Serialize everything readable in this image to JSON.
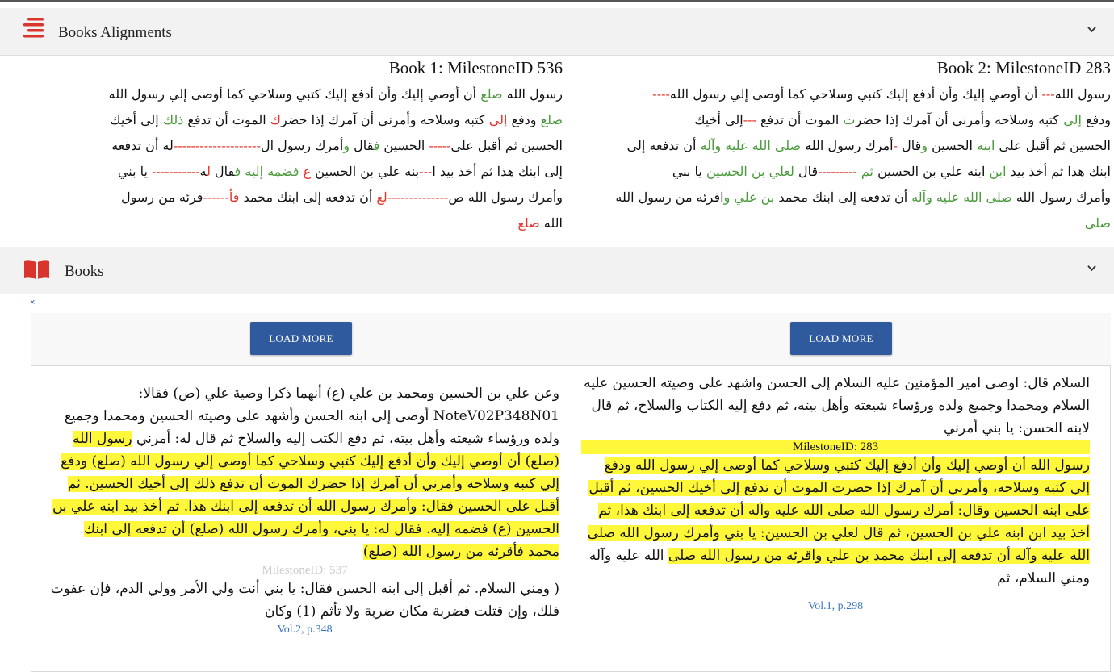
{
  "alignments_panel": {
    "title": "Books Alignments",
    "book1_heading": "Book 1: MilestoneID 536",
    "book2_heading": "Book 2: MilestoneID 283"
  },
  "book1_alignment_lines": [
    [
      {
        "t": "رسول الله "
      },
      {
        "t": "صلع",
        "c": "g"
      },
      {
        "t": " أن أوصي إليك وأن أدفع إليك كتبي وسلاحي كما أوصى إلي رسول الله"
      }
    ],
    [
      {
        "t": "صلع",
        "c": "g"
      },
      {
        "t": " ودفع "
      },
      {
        "t": "إلى",
        "c": "r"
      },
      {
        "t": " كتبه وسلاحه وأمرني أن آمرك إذا حضر"
      },
      {
        "t": "ك",
        "c": "r"
      },
      {
        "t": " الموت أن تدفع "
      },
      {
        "t": "ذلك",
        "c": "g"
      },
      {
        "t": " إلى أخيك"
      }
    ],
    [
      {
        "t": "الحسين ثم أقبل على"
      },
      {
        "t": "-----",
        "c": "r"
      },
      {
        "t": " الحسين "
      },
      {
        "t": "ف",
        "c": "g"
      },
      {
        "t": "قال "
      },
      {
        "t": "و",
        "c": "g"
      },
      {
        "t": "أمرك رسول ال"
      },
      {
        "t": "--------------------",
        "c": "r"
      },
      {
        "t": "له أن تدفعه"
      }
    ],
    [
      {
        "t": "إلى ابنك هذا ثم أخذ بيد ا"
      },
      {
        "t": "---",
        "c": "r"
      },
      {
        "t": "بنه علي بن الحسين "
      },
      {
        "t": "ع",
        "c": "r"
      },
      {
        "t": " "
      },
      {
        "t": "فضمه إليه",
        "c": "g"
      },
      {
        "t": " "
      },
      {
        "t": "ف",
        "c": "g"
      },
      {
        "t": "قال "
      },
      {
        "t": "ل",
        "c": "r"
      },
      {
        "t": "ه"
      },
      {
        "t": "-----------",
        "c": "r"
      },
      {
        "t": " يا بني"
      }
    ],
    [
      {
        "t": "وأمرك رسول الله ص"
      },
      {
        "t": "--------------",
        "c": "r"
      },
      {
        "t": "لع",
        "c": "r"
      },
      {
        "t": " أن تدفعه إلى ابنك محمد "
      },
      {
        "t": "فأ",
        "c": "r"
      },
      {
        "t": "------",
        "c": "r"
      },
      {
        "t": "قرئه من رسول"
      }
    ],
    [
      {
        "t": "الله "
      },
      {
        "t": "صلع",
        "c": "r"
      }
    ]
  ],
  "book2_alignment_lines": [
    [
      {
        "t": "رسول الله"
      },
      {
        "t": "---",
        "c": "r"
      },
      {
        "t": " أن أوصي إليك وأن أدفع إليك كتبي وسلاحي كما أوصى إلي رسول الله"
      },
      {
        "t": "----",
        "c": "r"
      }
    ],
    [
      {
        "t": "ودفع "
      },
      {
        "t": "إلي",
        "c": "g"
      },
      {
        "t": " كتبه وسلاحه وأمرني أن آمرك إذا حضر"
      },
      {
        "t": "ت",
        "c": "g"
      },
      {
        "t": " الموت أن تدفع "
      },
      {
        "t": "---",
        "c": "r"
      },
      {
        "t": "إلى أخيك"
      }
    ],
    [
      {
        "t": "الحسين ثم أقبل على "
      },
      {
        "t": "ابنه",
        "c": "g"
      },
      {
        "t": " الحسين "
      },
      {
        "t": "و",
        "c": "g"
      },
      {
        "t": "قال "
      },
      {
        "t": "-",
        "c": "r"
      },
      {
        "t": "أمرك رسول الله "
      },
      {
        "t": "صلى الله عليه",
        "c": "g"
      },
      {
        "t": " "
      },
      {
        "t": "وآله",
        "c": "g"
      },
      {
        "t": " أن تدفعه إلى"
      }
    ],
    [
      {
        "t": "ابنك هذا ثم أخذ بيد "
      },
      {
        "t": "ابن",
        "c": "g"
      },
      {
        "t": " ابنه علي بن الحسين "
      },
      {
        "t": "ثم",
        "c": "g"
      },
      {
        "t": " "
      },
      {
        "t": "---------",
        "c": "r"
      },
      {
        "t": "قال "
      },
      {
        "t": "لعلي بن الحسين",
        "c": "g"
      },
      {
        "t": " يا بني"
      }
    ],
    [
      {
        "t": "وأمرك رسول الله "
      },
      {
        "t": "صلى الله عليه وآله",
        "c": "g"
      },
      {
        "t": " أن تدفعه إلى ابنك محمد "
      },
      {
        "t": "بن علي",
        "c": "g"
      },
      {
        "t": " "
      },
      {
        "t": "و",
        "c": "g"
      },
      {
        "t": "اقرئه من رسول الله"
      }
    ],
    [
      {
        "t": "صلى",
        "c": "g"
      }
    ]
  ],
  "books_panel": {
    "title": "Books",
    "close_symbol": "×",
    "load_more_label": "LOAD MORE"
  },
  "book1_page": {
    "before": "وعن علي بن الحسين ومحمد بن علي (ع) أنهما ذكرا وصية علي (ص) فقالا: NoteV02P348N01 أوصى إلى ابنه الحسن وأشهد على وصيته الحسين ومحمدا وجميع ولده ورؤساء شيعته وأهل بيته، ثم دفع الكتب إليه والسلاح ثم قال له: أمرني ",
    "highlight": "رسول الله (صلع) أن أوصي إليك وأن أدفع إليك كتبي وسلاحي كما أوصى إلي رسول الله (صلع) ودفع إلي كتبه وسلاحه وأمرني أن آمرك إذا حضرك الموت أن تدفع ذلك إلى أخيك الحسين. ثم أقبل على الحسين فقال: وأمرك رسول الله أن تدفعه إلى ابنك هذا. ثم أخذ بيد ابنه علي بن الحسين (ع) فضمه إليه. فقال له: يا بني، وأمرك رسول الله (صلع) أن تدفعه إلى ابنك محمد فأقرئه من رسول الله (صلع)",
    "milestone": "MilestoneID: 537",
    "after": "( ومني السلام. ثم أقبل إلى ابنه الحسن فقال: يا بني أنت ولي الأمر وولي الدم، فإن عفوت فلك، وإن قتلت فضربة مكان ضربة ولا تأثم (1) وكان",
    "volume": "Vol.2, p.348"
  },
  "book2_page": {
    "before": "السلام قال: اوصى امير المؤمنين عليه السلام إلى الحسن واشهد على وصيته الحسين عليه السلام ومحمدا وجميع ولده ورؤساء شيعته وأهل بيته، ثم دفع إليه الكتاب والسلاح، ثم قال لابنه الحسن: يا بني أمرني",
    "milestone": "MilestoneID: 283",
    "highlight": "رسول الله أن أوصي إليك وأن أدفع إليك كتبي وسلاحي كما أوصى إلي رسول الله ودفع إلي كتبه وسلاحه، وأمرني أن آمرك إذا حضرت الموت أن تدفع إلى أخيك الحسين، ثم أقبل على ابنه الحسين وقال: أمرك رسول الله صلى الله عليه وآله أن تدفعه إلى ابنك هذا، ثم أخذ بيد ابن ابنه علي بن الحسين، ثم قال لعلي بن الحسين: يا بني وأمرك رسول الله صلى الله عليه وآله أن تدفعه إلى ابنك محمد بن علي واقرئه من رسول الله صلى",
    "after": " الله عليه وآله ومني السلام، ثم",
    "volume": "Vol.1, p.298"
  }
}
